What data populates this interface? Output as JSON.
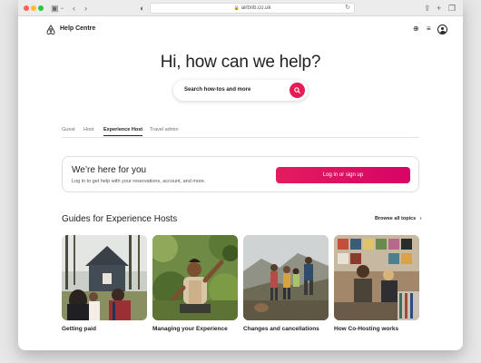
{
  "browser": {
    "url": "airbnb.co.uk"
  },
  "header": {
    "site_title": "Help Centre"
  },
  "hero": {
    "title": "Hi, how can we help?",
    "search_placeholder": "Search how-tos and more"
  },
  "tabs": [
    {
      "label": "Guest",
      "active": false
    },
    {
      "label": "Host",
      "active": false
    },
    {
      "label": "Experience Host",
      "active": true
    },
    {
      "label": "Travel admin",
      "active": false
    }
  ],
  "support_card": {
    "title": "We’re here for you",
    "subtitle": "Log in to get help with your reservations, account, and more.",
    "button_label": "Log in or sign up"
  },
  "guides": {
    "section_title": "Guides for Experience Hosts",
    "browse_label": "Browse all topics",
    "items": [
      {
        "label": "Getting paid",
        "image": "family-at-cabin-photo"
      },
      {
        "label": "Managing your Experience",
        "image": "gardener-photo"
      },
      {
        "label": "Changes and cancellations",
        "image": "hikers-photo"
      },
      {
        "label": "How Co-Hosting works",
        "image": "record-shop-photo"
      }
    ]
  },
  "colors": {
    "brand": "#e31c5f",
    "text": "#222222",
    "muted": "#717171"
  },
  "icons": [
    "sidebar-icon",
    "back-icon",
    "forward-icon",
    "shield-icon",
    "lock-icon",
    "reload-icon",
    "share-icon",
    "new-tab-icon",
    "tabs-icon",
    "airbnb-logo-icon",
    "globe-icon",
    "menu-icon",
    "user-icon",
    "search-icon",
    "chevron-right-icon"
  ]
}
